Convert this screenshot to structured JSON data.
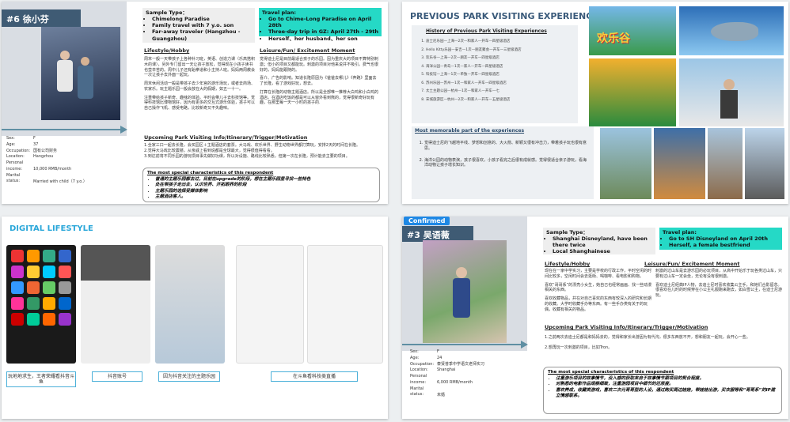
{
  "s1": {
    "title": "#6 徐小芬",
    "sample_title": "Sample Type：",
    "sample_items": [
      "Chimelong Paradise",
      "Family travel with 7 y.o. son",
      "Far-away traveler (Hangzhou - Guangzhou)"
    ],
    "travel_title": "Travel plan:",
    "travel_items": [
      "Go to Chime-Long Paradise on April 28th",
      "Three-day trip in GZ: April 27th - 29th",
      "Herself、her husband、her son"
    ],
    "lifestyle_title": "Lifestyle/Hobby",
    "lifestyle_text": [
      "周末一般一天带孩子上各种补习班，英语、创造力课（乐高搭积木的课），另外专门留出一天让孩子放松，觉得现在小孩子读书也蛮辛苦的。周中儿子还有跆拳道和小主持人班。妈妈两周教会一次让孩子去外面一起玩。",
      "周末休闲活动一般是带孩子去少年宫的游乐场玩，或者去商场、农家乐。玩主题乐园一般会放在大的假期，如五一十一。",
      "注重带给孩子新奇、趣味的体验。平时会带儿子去科技馆等。觉得科技馆比博物馆好，因为有更多的交互式游乐体验，孩子可以自己操作飞机、感受电路，比较新奇又不失趣味。"
    ],
    "leisure_title": "Leisure/Fun/ Excitement Moment",
    "leisure_text": [
      "觉得迪士尼是目前最适合孩子的乐园。因为重庆大的项目不算特别刺激；但小的项目又都能玩。刺激的项目对他来说并不吸引。费气也很好的，妈妈能跟随的。",
      "喜介、广告的影响。知道长隆原因为《爸爸去哪儿》《奔跑》里面去了长隆，看了游戏好玩，想去。",
      "打算在长隆的动物主题酒店。所以是全部唯一推荐大白鸡和小白鸡的酒店。在酒店吃饭的都是可以从窗外看到熊的，觉得很新奇好玩有趣，在那里每一天一小时的孩子的."
    ],
    "fields": [
      {
        "k": "Sex:",
        "v": "F"
      },
      {
        "k": "Age:",
        "v": "37"
      },
      {
        "k": "Occupation:",
        "v": "国有公司财务"
      },
      {
        "k": "Location:",
        "v": "Hangzhou"
      },
      {
        "k": "Personal income:",
        "v": "10,000 RMB/month"
      },
      {
        "k": "Marital status:",
        "v": "Married with child（7 y.o.）"
      }
    ],
    "upcoming_title": "Upcoming Park Visiting Info/Itinerary/Trigger/Motivation",
    "upcoming_text": [
      "1.全家三口一起去长隆，会买园区＋主题酒店的套票。大马戏、欢乐世界、野生动物世界都打算玩，安排2天的时间在长隆。",
      "2.觉得大马戏比较震撼，从亲戚上看到说都是全球最大，觉得很值得看看。",
      "3.到达前将不同乐园的游玩项目事先做好功课，所以对设施、路线比较熟悉，但第一次在长隆，预计能去主要的项目。"
    ],
    "special_title": "The most special characteristics of this respondent",
    "special_items": [
      "普通的主题乐园都去过，目前在upgrade的阶段，想在主题乐园里寻找一些特色",
      "处在带孩子走出去，认识世界、开拓眼界的阶段",
      "主题乐园的选择受媒体影响",
      "主题酒店客人。"
    ]
  },
  "s2": {
    "title": "PREVIOUS PARK VISITING EXPERIENCES",
    "history_title": "History of Previous Park Visiting Experiences",
    "history_items": [
      "迪士尼乐园—上海—2次—和家人—开车—四星级酒店",
      "Hello Kitty乐园—安吉—1次—朋友聚会—开车—三星级酒店",
      "欢乐谷—上海—2次—朋友—开车—四星级酒店",
      "海洋公园—青岛—1次—家人—开车—四星级酒店",
      "科技馆—上海—1次—单独—开车—四星级酒店",
      "苏州乐园—苏州—1次—和家人—开车—四星级酒店",
      "太土主题公园—杭州—1次—和家人—开车—七",
      "宋城旅游区—杭州—2次—和家人—开车—五星级酒店"
    ],
    "memorable_title": "Most memorable part of the experiences",
    "memorable_items": [
      "觉得迪士尼的飞越地平线、梦想和创意的、大火箭、新颖又很有冲击力，带着孩子玩也很有意思。",
      "海洋公园的动物表演，孩子很喜欢，小孩子看完之后很有成就感。觉得很适合亲子游玩，看海洋动物让孩子增长知识。"
    ],
    "banner_text": "欢乐谷"
  },
  "s3": {
    "title": "DIGITAL LIFESTYLE",
    "captions": [
      "玩地地求生，王者荣耀看抖音斗鱼",
      "抖音账号",
      "因为抖音关注的主题乐园",
      "在斗鱼看科技类直播"
    ]
  },
  "s4": {
    "badge": "Confirmed",
    "title": "#3 吴语薇",
    "sample_title": "Sample Type：",
    "sample_items": [
      "Shanghai Disneyland, have been there twice",
      "Local Shanghainese"
    ],
    "travel_title": "Travel plan:",
    "travel_items": [
      "Go to SH Disneyland on April 20th",
      "Herself, a female bestfriend"
    ],
    "lifestyle_title": "Lifestyle/Hobby",
    "lifestyle_text": [
      "现在在一家中学实习，主要是学校的行政工作，平时空闲的时间比较多，空闲时间会去逛街、喝咖啡、看电影和购物。",
      "喜欢“哥哥系”的漂亮小女生，她自己也经常画画、找一些动漫相关的东西。",
      "喜欢收藏物品，并在对自己喜欢的东西有较深入的研究和长期的收藏。大学时收藏手办等东西。有一些手办类有关于的玩偶，收藏有相关的物品。"
    ],
    "leisure_title": "Leisure/Fun/ Excitement Moment",
    "leisure_text": [
      "刺激的过山车是去游乐园的必玩项目，从高中开始乐于玩各类过山车，只要有过山车一定会坐，无论有没有很刺激。",
      "喜欢迪士尼经典IP人物，去迪士尼时喜欢收集公主手，和她们合影留念。很喜欢在儿时的时候穿在小公主礼服跑来跑去，如白雪公主，在迪士尼游玩。"
    ],
    "fields": [
      {
        "k": "Sex:",
        "v": "F"
      },
      {
        "k": "Age:",
        "v": "24"
      },
      {
        "k": "Occupation:",
        "v": "泰贤普季中学语文老师实习"
      },
      {
        "k": "Location:",
        "v": "Shanghai"
      },
      {
        "k": "Personal income:",
        "v": "6,000 RMB/month"
      },
      {
        "k": "Marital status:",
        "v": "未婚"
      }
    ],
    "upcoming_title": "Upcoming Park Visiting Info/Itinerary/Trigger/Motivation",
    "upcoming_text": [
      "1.之前两次去迪士尼都是和妈妈去的，觉得和家长出游因为有代沟，很多东西放不开，想和朋友一起玩，会开心一些。",
      "2.想再玩一次刺激的项目，比如Tron。"
    ],
    "special_title": "The most special characteristics of this respondent",
    "special_items": [
      "注重游乐项目的故事情节，没入感的获取来自于故事情节跟项目的契合程度。",
      "对熟悉的电影作品观察细致，注重游园项目中细节的还原度。",
      "喜欢养成，收藏类游戏，喜欢二次元哥哥型的人设，通过购买周边娃娃，带娃娃出游，买衣服等和“哥哥系”的IP建立情感联系。"
    ]
  }
}
